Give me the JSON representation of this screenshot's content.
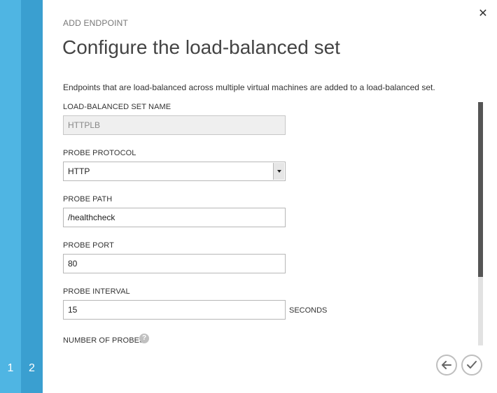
{
  "steps": [
    {
      "label": "1"
    },
    {
      "label": "2"
    }
  ],
  "header": {
    "eyebrow": "ADD ENDPOINT",
    "title": "Configure the load-balanced set"
  },
  "description": "Endpoints that are load-balanced across multiple virtual machines are added to a load-balanced set.",
  "fields": {
    "set_name": {
      "label": "LOAD-BALANCED SET NAME",
      "value": "HTTPLB"
    },
    "probe_protocol": {
      "label": "PROBE PROTOCOL",
      "value": "HTTP"
    },
    "probe_path": {
      "label": "PROBE PATH",
      "value": "/healthcheck"
    },
    "probe_port": {
      "label": "PROBE PORT",
      "value": "80"
    },
    "probe_interval": {
      "label": "PROBE INTERVAL",
      "value": "15",
      "unit": "SECONDS"
    },
    "number_of_probes": {
      "label": "NUMBER OF PROBES",
      "help_icon": "?"
    }
  },
  "icons": {
    "close": "close-icon",
    "back": "back-arrow-icon",
    "finish": "checkmark-icon",
    "help": "help-icon"
  },
  "colors": {
    "step1": "#4fb5e3",
    "step2": "#3a9fd0"
  }
}
